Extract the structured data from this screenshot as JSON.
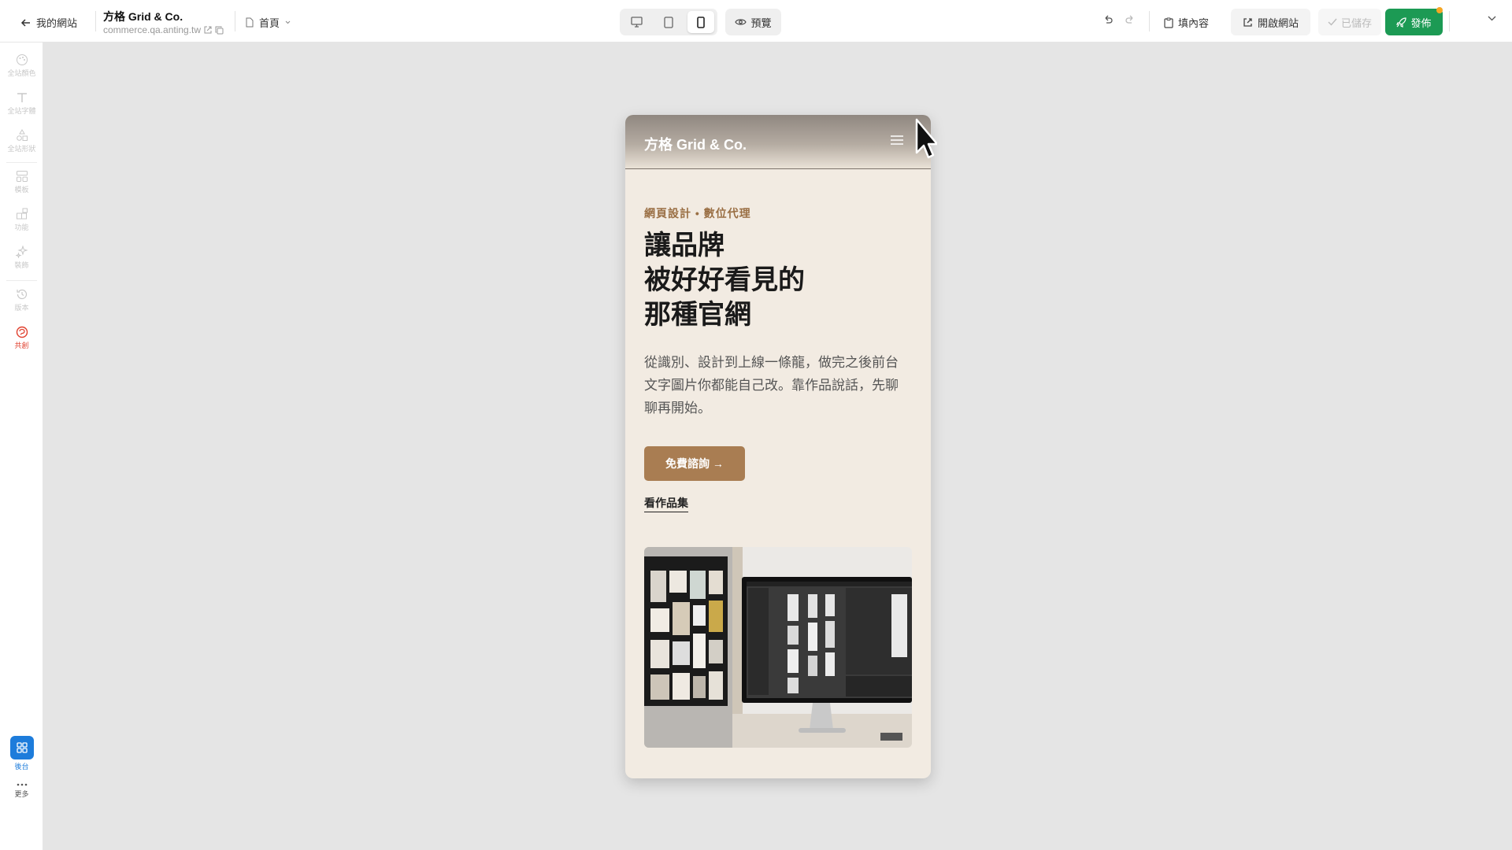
{
  "header": {
    "back_label": "我的網站",
    "site_name": "方格 Grid & Co.",
    "site_domain": "commerce.qa.anting.tw",
    "page_selector": "首頁",
    "preview_label": "預覽",
    "fill_content_label": "填內容",
    "open_site_label": "開啟網站",
    "saved_label": "已儲存",
    "publish_label": "發佈",
    "active_device": "mobile"
  },
  "sidebar": {
    "items": [
      {
        "label": "全站顏色",
        "icon": "palette-icon"
      },
      {
        "label": "全站字體",
        "icon": "type-icon"
      },
      {
        "label": "全站形狀",
        "icon": "shapes-icon"
      },
      {
        "label": "模板",
        "icon": "layout-icon"
      },
      {
        "label": "功能",
        "icon": "blocks-icon"
      },
      {
        "label": "裝飾",
        "icon": "sparkles-icon"
      },
      {
        "label": "版本",
        "icon": "history-icon"
      },
      {
        "label": "共創",
        "icon": "collab-icon"
      }
    ],
    "backend_label": "後台",
    "more_label": "更多"
  },
  "preview": {
    "logo": "方格 Grid & Co.",
    "tagline": "網頁設計 • 數位代理",
    "headline_lines": [
      "讓品牌",
      "被好好看見的",
      "那種官網"
    ],
    "description": "從識別、設計到上線一條龍，做完之後前台文字圖片你都能自己改。靠作品說話，先聊聊再開始。",
    "cta_label": "免費諮詢 →",
    "portfolio_link": "看作品集"
  },
  "colors": {
    "accent_brown": "#a97d52",
    "publish_green": "#1c9a54",
    "collab_red": "#e0402e",
    "backend_blue": "#1d7cdb",
    "preview_bg": "#f2ebe2"
  }
}
